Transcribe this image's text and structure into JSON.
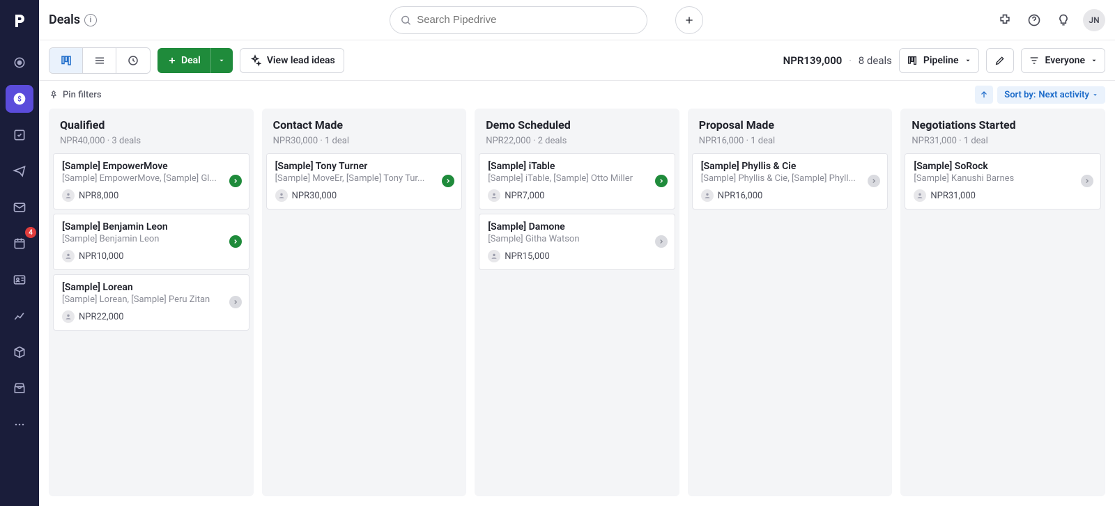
{
  "header": {
    "title": "Deals",
    "search_placeholder": "Search Pipedrive",
    "avatar_initials": "JN"
  },
  "sidebar": {
    "activity_badge": "4"
  },
  "toolbar": {
    "deal_button": "Deal",
    "lead_ideas": "View lead ideas",
    "total_value": "NPR139,000",
    "deal_count": "8 deals",
    "pipeline_label": "Pipeline",
    "filter_label": "Everyone"
  },
  "filter_row": {
    "pin_filters": "Pin filters",
    "sort_prefix": "Sort by: ",
    "sort_value": "Next activity"
  },
  "columns": [
    {
      "title": "Qualified",
      "value": "NPR40,000",
      "count": "3 deals",
      "cards": [
        {
          "title": "[Sample] EmpowerMove",
          "subtitle": "[Sample] EmpowerMove, [Sample] Gl...",
          "amount": "NPR8,000",
          "status": "green"
        },
        {
          "title": "[Sample] Benjamin Leon",
          "subtitle": "[Sample] Benjamin Leon",
          "amount": "NPR10,000",
          "status": "green"
        },
        {
          "title": "[Sample] Lorean",
          "subtitle": "[Sample] Lorean, [Sample] Peru Zitan",
          "amount": "NPR22,000",
          "status": "gray"
        }
      ]
    },
    {
      "title": "Contact Made",
      "value": "NPR30,000",
      "count": "1 deal",
      "cards": [
        {
          "title": "[Sample] Tony Turner",
          "subtitle": "[Sample] MoveEr, [Sample] Tony Tur...",
          "amount": "NPR30,000",
          "status": "green"
        }
      ]
    },
    {
      "title": "Demo Scheduled",
      "value": "NPR22,000",
      "count": "2 deals",
      "cards": [
        {
          "title": "[Sample] iTable",
          "subtitle": "[Sample] iTable, [Sample] Otto Miller",
          "amount": "NPR7,000",
          "status": "green"
        },
        {
          "title": "[Sample] Damone",
          "subtitle": "[Sample] Githa Watson",
          "amount": "NPR15,000",
          "status": "gray"
        }
      ]
    },
    {
      "title": "Proposal Made",
      "value": "NPR16,000",
      "count": "1 deal",
      "cards": [
        {
          "title": "[Sample] Phyllis & Cie",
          "subtitle": "[Sample] Phyllis & Cie, [Sample] Phyll...",
          "amount": "NPR16,000",
          "status": "gray"
        }
      ]
    },
    {
      "title": "Negotiations Started",
      "value": "NPR31,000",
      "count": "1 deal",
      "cards": [
        {
          "title": "[Sample] SoRock",
          "subtitle": "[Sample] Kanushi Barnes",
          "amount": "NPR31,000",
          "status": "gray"
        }
      ]
    }
  ]
}
